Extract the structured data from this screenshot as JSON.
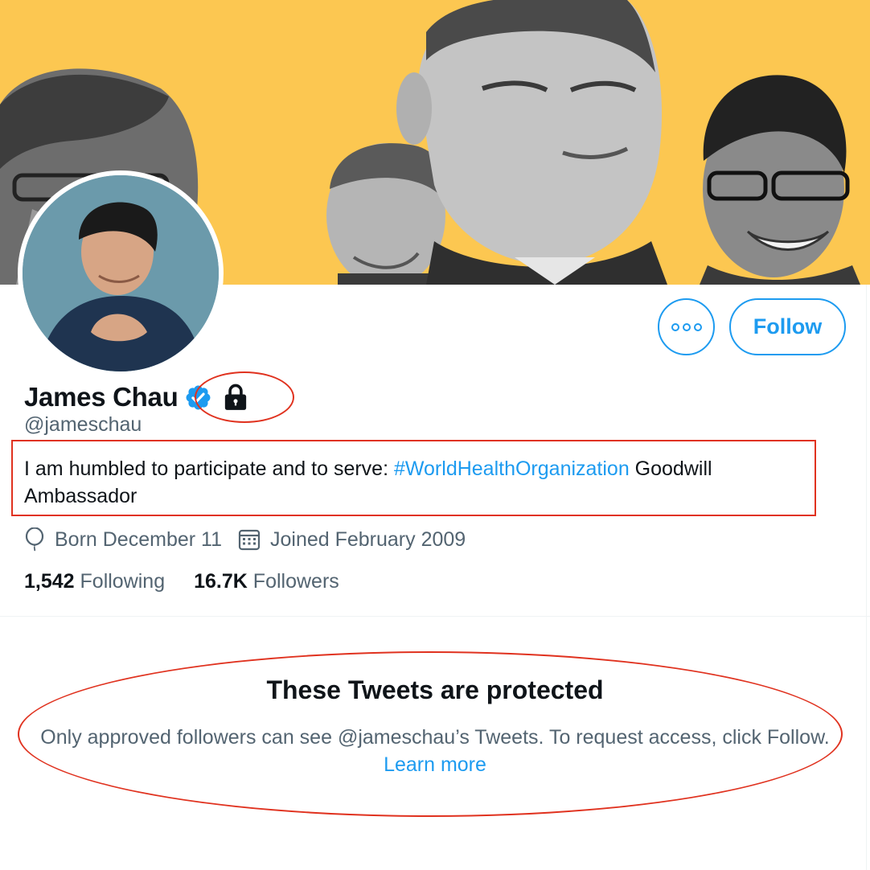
{
  "profile": {
    "display_name": "James Chau",
    "handle": "@jameschau",
    "bio_before": "I am humbled to participate and to serve: ",
    "bio_hashtag": "#WorldHealthOrganization",
    "bio_after": " Goodwill Ambassador",
    "birthday": "Born December 11",
    "joined": "Joined February 2009",
    "following_count": "1,542",
    "following_label": "Following",
    "followers_count": "16.7K",
    "followers_label": "Followers"
  },
  "actions": {
    "follow_label": "Follow",
    "more_icon": "more-icon"
  },
  "protected_notice": {
    "title": "These Tweets are protected",
    "text": "Only approved followers can see @jameschau’s Tweets. To request access, click Follow. ",
    "learn_more": "Learn more"
  },
  "icons": [
    "verified-badge-icon",
    "lock-icon",
    "balloon-icon",
    "calendar-icon"
  ],
  "colors": {
    "banner": "#fcc751",
    "accent": "#1d9bf0",
    "secondary_text": "#536471",
    "annotation": "#e0321f"
  }
}
